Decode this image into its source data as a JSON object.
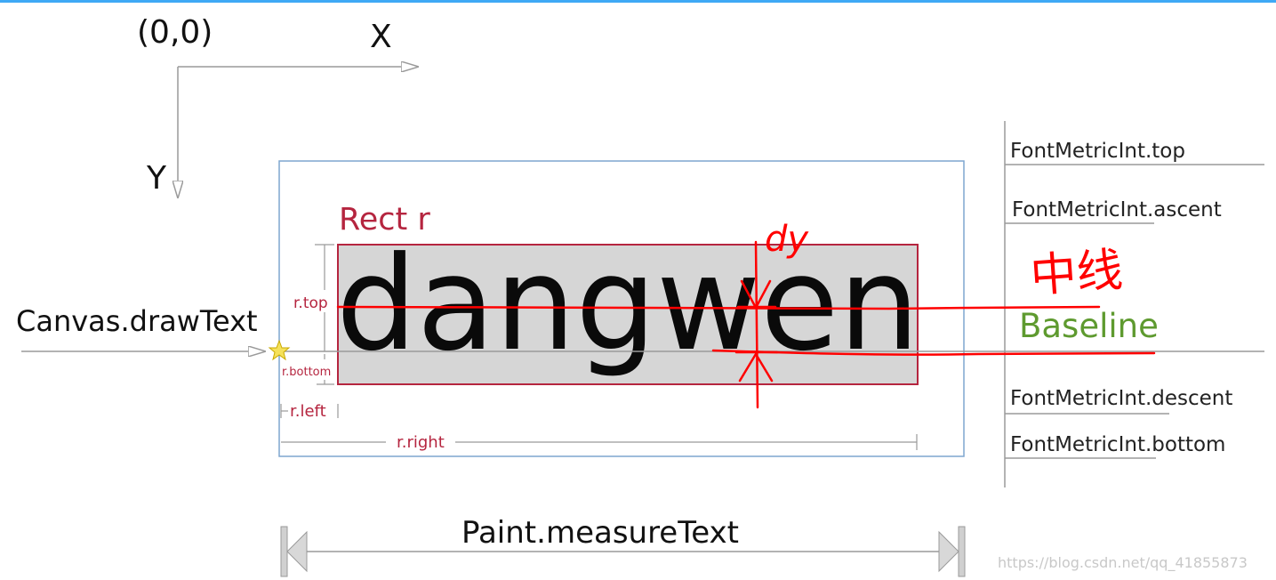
{
  "coords": {
    "origin_label": "(0,0)",
    "x_label": "X",
    "y_label": "Y"
  },
  "canvas": {
    "draw_text_label": "Canvas.drawText"
  },
  "rect": {
    "title": "Rect r",
    "sample_text": "dangwen",
    "top_label": "r.top",
    "bottom_label": "r.bottom",
    "left_label": "r.left",
    "right_label": "r.right"
  },
  "metrics": {
    "top": "FontMetricInt.top",
    "ascent": "FontMetricInt.ascent",
    "baseline": "Baseline",
    "descent": "FontMetricInt.descent",
    "bottom": "FontMetricInt.bottom"
  },
  "measure": {
    "label": "Paint.measureText"
  },
  "annotations": {
    "dy": "dy",
    "center_line": "中线"
  },
  "watermark": "https://blog.csdn.net/qq_41855873",
  "colors": {
    "rect_red": "#b5253f",
    "outer_box_blue": "#7ea6cf",
    "baseline_green": "#5e9a2f",
    "annotation_red": "#ff0000",
    "axis_gray": "#9a9a9a",
    "rect_fill": "#d6d6d6"
  }
}
